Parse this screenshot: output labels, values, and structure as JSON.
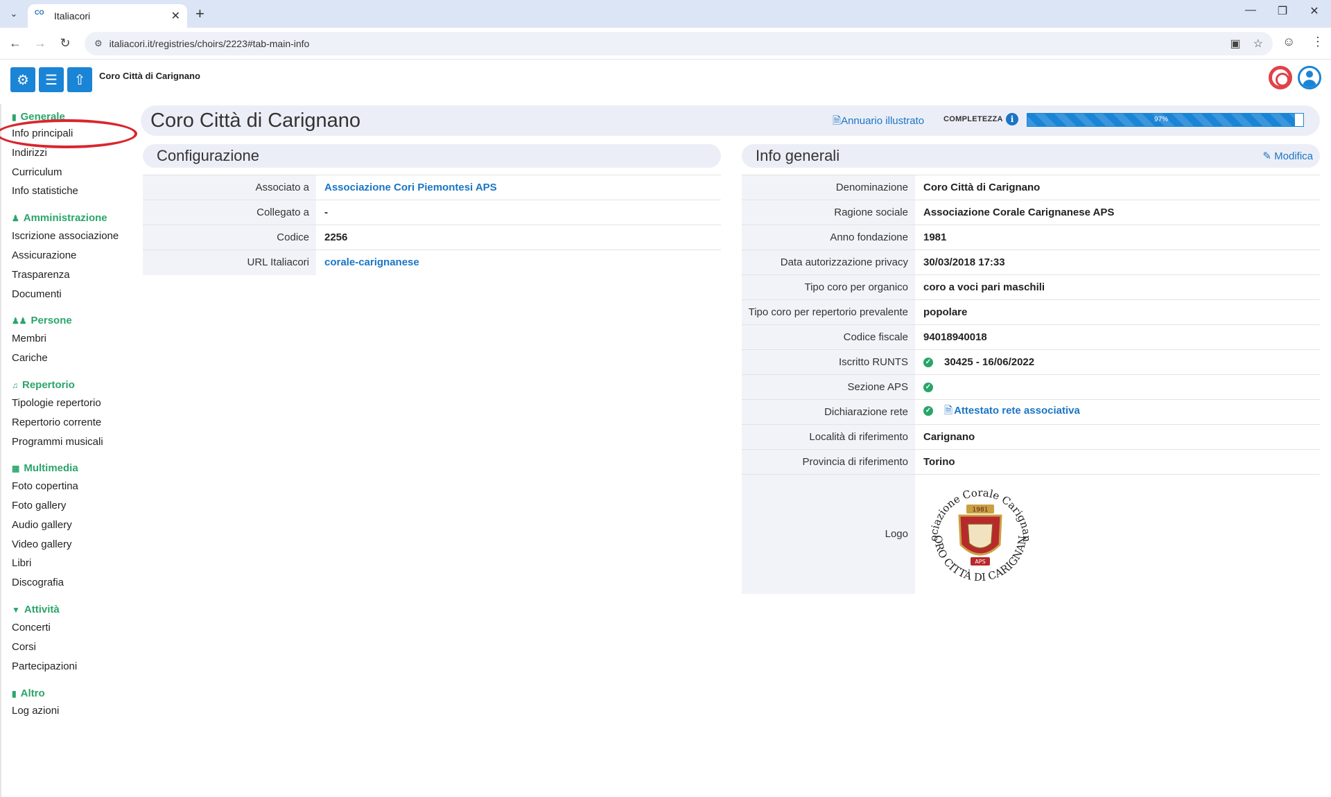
{
  "browser": {
    "tab_title": "Italiacori",
    "tab_favicon_text": "CO",
    "url": "italiacori.it/registries/choirs/2223#tab-main-info"
  },
  "header": {
    "org_name": "Coro Città di Carignano"
  },
  "sidebar": {
    "sections": [
      {
        "label": "Generale",
        "icon": "check-badge-icon",
        "items": [
          "Info principali",
          "Indirizzi",
          "Curriculum",
          "Info statistiche"
        ]
      },
      {
        "label": "Amministrazione",
        "icon": "person-icon",
        "items": [
          "Iscrizione associazione",
          "Assicurazione",
          "Trasparenza",
          "Documenti"
        ]
      },
      {
        "label": "Persone",
        "icon": "people-icon",
        "items": [
          "Membri",
          "Cariche"
        ]
      },
      {
        "label": "Repertorio",
        "icon": "music-note-icon",
        "items": [
          "Tipologie repertorio",
          "Repertorio corrente",
          "Programmi musicali"
        ]
      },
      {
        "label": "Multimedia",
        "icon": "multimedia-icon",
        "items": [
          "Foto copertina",
          "Foto gallery",
          "Audio gallery",
          "Video gallery",
          "Libri",
          "Discografia"
        ]
      },
      {
        "label": "Attività",
        "icon": "chevron-circle-icon",
        "items": [
          "Concerti",
          "Corsi",
          "Partecipazioni"
        ]
      },
      {
        "label": "Altro",
        "icon": "folder-icon",
        "items": [
          "Log azioni"
        ]
      }
    ]
  },
  "main": {
    "title": "Coro Città di Carignano",
    "annuario_label": "Annuario illustrato",
    "completezza_label": "COMPLETEZZA",
    "progress": {
      "value": 97,
      "label": "97%"
    }
  },
  "configurazione": {
    "title": "Configurazione",
    "rows": [
      {
        "key": "Associato a",
        "value": "Associazione Cori Piemontesi APS",
        "link": true
      },
      {
        "key": "Collegato a",
        "value": "-",
        "link": false
      },
      {
        "key": "Codice",
        "value": "2256",
        "link": false
      },
      {
        "key": "URL Italiacori",
        "value": "corale-carignanese",
        "link": true
      }
    ]
  },
  "info_generali": {
    "title": "Info generali",
    "edit_label": "Modifica",
    "rows": [
      {
        "key": "Denominazione",
        "value": "Coro Città di Carignano"
      },
      {
        "key": "Ragione sociale",
        "value": "Associazione Corale Carignanese APS"
      },
      {
        "key": "Anno fondazione",
        "value": "1981"
      },
      {
        "key": "Data autorizzazione privacy",
        "value": "30/03/2018 17:33"
      },
      {
        "key": "Tipo coro per organico",
        "value": "coro a voci pari maschili"
      },
      {
        "key": "Tipo coro per repertorio prevalente",
        "value": "popolare"
      },
      {
        "key": "Codice fiscale",
        "value": "94018940018"
      },
      {
        "key": "Iscritto RUNTS",
        "value": "30425 - 16/06/2022",
        "check": true
      },
      {
        "key": "Sezione APS",
        "value": "",
        "check": true
      },
      {
        "key": "Dichiarazione rete",
        "value": "Attestato rete associativa",
        "check": true,
        "link": true
      },
      {
        "key": "Località di riferimento",
        "value": "Carignano"
      },
      {
        "key": "Provincia di riferimento",
        "value": "Torino"
      }
    ],
    "logo_key": "Logo",
    "logo": {
      "text_top": "Associazione Corale Carignanese",
      "text_bottom": "CORO CITTÀ DI CARIGNANO",
      "year": "1981",
      "badge": "APS"
    }
  },
  "colors": {
    "accent": "#1a84d6",
    "section_green": "#2aa56a",
    "annotation_red": "#d8262e"
  }
}
